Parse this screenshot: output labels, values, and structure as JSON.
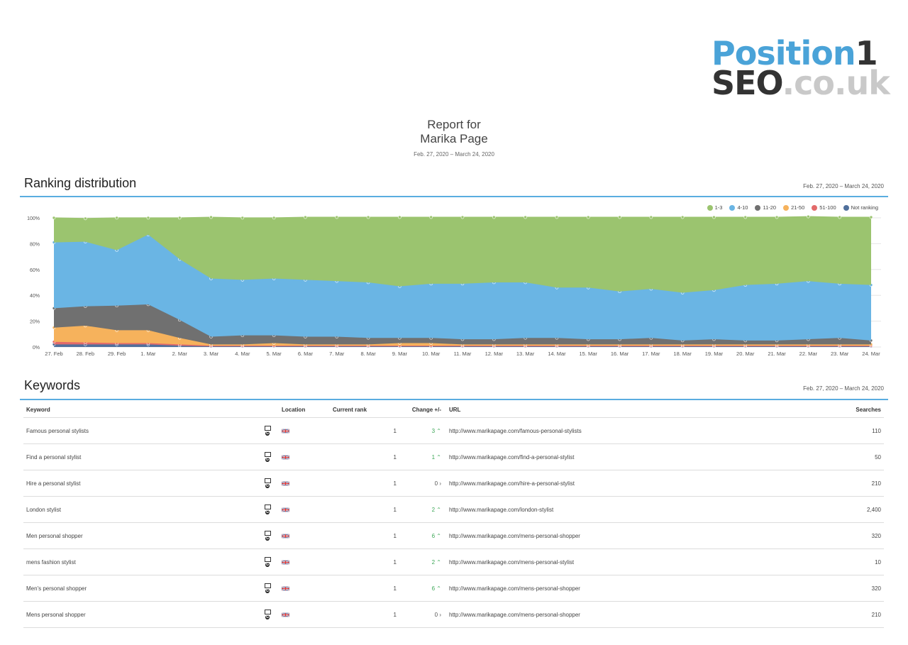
{
  "logo": {
    "word1": "Position",
    "num": "1",
    "word2": "SEO",
    "domain": ".co.uk"
  },
  "header": {
    "line1": "Report for",
    "line2": "Marika Page",
    "date_range": "Feb. 27, 2020 – March 24, 2020"
  },
  "ranking": {
    "title": "Ranking distribution",
    "date_range": "Feb. 27, 2020 – March 24, 2020"
  },
  "keywords_section": {
    "title": "Keywords",
    "date_range": "Feb. 27, 2020 – March 24, 2020"
  },
  "colors": {
    "accent": "#5aade0",
    "s1_3": "#9bc46f",
    "s4_10": "#6ab5e4",
    "s11_20": "#707070",
    "s21_50": "#f6b25c",
    "s51_100": "#e36a6a",
    "not_ranking": "#50709c"
  },
  "chart_data": {
    "type": "area",
    "stacked": true,
    "ylim": [
      0,
      100
    ],
    "y_ticks": [
      "0%",
      "20%",
      "40%",
      "60%",
      "80%",
      "100%"
    ],
    "grid": true,
    "legend_position": "top-right",
    "categories": [
      "27. Feb",
      "28. Feb",
      "29. Feb",
      "1. Mar",
      "2. Mar",
      "3. Mar",
      "4. Mar",
      "5. Mar",
      "6. Mar",
      "7. Mar",
      "8. Mar",
      "9. Mar",
      "10. Mar",
      "11. Mar",
      "12. Mar",
      "13. Mar",
      "14. Mar",
      "15. Mar",
      "16. Mar",
      "17. Mar",
      "18. Mar",
      "19. Mar",
      "20. Mar",
      "21. Mar",
      "22. Mar",
      "23. Mar",
      "24. Mar"
    ],
    "series": [
      {
        "name": "Not ranking",
        "color": "#50709c",
        "values": [
          2,
          2,
          2,
          2,
          1,
          0.5,
          0.5,
          0.5,
          0.5,
          0.5,
          0.5,
          0.5,
          0.5,
          0.5,
          0.5,
          0.5,
          0.5,
          0.5,
          0.5,
          0.5,
          0.5,
          0.5,
          0.5,
          0.5,
          0.5,
          0.5,
          0.5
        ]
      },
      {
        "name": "51-100",
        "color": "#e36a6a",
        "values": [
          2,
          1.5,
          1,
          1,
          1,
          0.5,
          0.5,
          0.5,
          0.5,
          0.5,
          0.5,
          0.5,
          0.5,
          0.5,
          0.5,
          0.5,
          0.5,
          0.5,
          0.5,
          0.5,
          0.5,
          0.5,
          0.5,
          0.5,
          0.5,
          0.5,
          0.5
        ]
      },
      {
        "name": "21-50",
        "color": "#f6b25c",
        "values": [
          11,
          13,
          10,
          10,
          5,
          1,
          1,
          2,
          1,
          1,
          1,
          2,
          2,
          1,
          1,
          1,
          1,
          1,
          1,
          1,
          1,
          1,
          1,
          1,
          1,
          1,
          1
        ]
      },
      {
        "name": "11-20",
        "color": "#707070",
        "values": [
          15,
          15,
          19,
          20,
          14,
          6,
          7,
          6,
          6,
          6,
          5,
          4,
          4,
          4,
          4,
          5,
          5,
          4,
          4,
          5,
          3,
          4,
          3,
          3,
          4,
          5,
          3
        ]
      },
      {
        "name": "4-10",
        "color": "#6ab5e4",
        "values": [
          51,
          50,
          43,
          54,
          47,
          45,
          43,
          44,
          44,
          43,
          43,
          40,
          42,
          43,
          44,
          43,
          39,
          40,
          37,
          38,
          37,
          38,
          43,
          44,
          45,
          42,
          43
        ]
      },
      {
        "name": "1-3",
        "color": "#9bc46f",
        "values": [
          19,
          18,
          25,
          13,
          32,
          47.5,
          48,
          47,
          48.5,
          49.5,
          50.5,
          53.5,
          51.5,
          51.5,
          50.5,
          50.5,
          54.5,
          54.5,
          57.5,
          55.5,
          58.5,
          56.5,
          52.5,
          51.5,
          50,
          51.5,
          52.5
        ]
      }
    ]
  },
  "table": {
    "headers": {
      "keyword": "Keyword",
      "location": "Location",
      "rank": "Current rank",
      "change": "Change +/-",
      "url": "URL",
      "searches": "Searches"
    },
    "rows": [
      {
        "keyword": "Famous personal stylists",
        "rank": "1",
        "change": "3",
        "change_dir": "up",
        "url": "http://www.marikapage.com/famous-personal-stylists",
        "searches": "110"
      },
      {
        "keyword": "Find a personal stylist",
        "rank": "1",
        "change": "1",
        "change_dir": "up",
        "url": "http://www.marikapage.com/find-a-personal-stylist",
        "searches": "50"
      },
      {
        "keyword": "Hire a personal stylist",
        "rank": "1",
        "change": "0",
        "change_dir": "none",
        "url": "http://www.marikapage.com/hire-a-personal-stylist",
        "searches": "210"
      },
      {
        "keyword": "London stylist",
        "rank": "1",
        "change": "2",
        "change_dir": "up",
        "url": "http://www.marikapage.com/london-stylist",
        "searches": "2,400"
      },
      {
        "keyword": "Men personal shopper",
        "rank": "1",
        "change": "6",
        "change_dir": "up",
        "url": "http://www.marikapage.com/mens-personal-shopper",
        "searches": "320"
      },
      {
        "keyword": "mens fashion stylist",
        "rank": "1",
        "change": "2",
        "change_dir": "up",
        "url": "http://www.marikapage.com/mens-personal-stylist",
        "searches": "10"
      },
      {
        "keyword": "Men's personal shopper",
        "rank": "1",
        "change": "6",
        "change_dir": "up",
        "url": "http://www.marikapage.com/mens-personal-shopper",
        "searches": "320"
      },
      {
        "keyword": "Mens personal shopper",
        "rank": "1",
        "change": "0",
        "change_dir": "none",
        "url": "http://www.marikapage.com/mens-personal-shopper",
        "searches": "210"
      }
    ]
  }
}
